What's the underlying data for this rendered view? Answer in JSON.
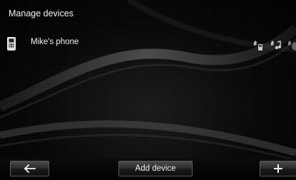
{
  "header": {
    "title": "Manage devices"
  },
  "devices": [
    {
      "name": "Mike's phone",
      "icon": "mobile-phone-icon",
      "services": [
        "phone-call-service-icon",
        "audio-streaming-service-icon",
        "internet-service-icon"
      ]
    }
  ],
  "footer": {
    "back_icon": "back-arrow-icon",
    "add_label": "Add device",
    "plus_icon": "plus-icon"
  }
}
